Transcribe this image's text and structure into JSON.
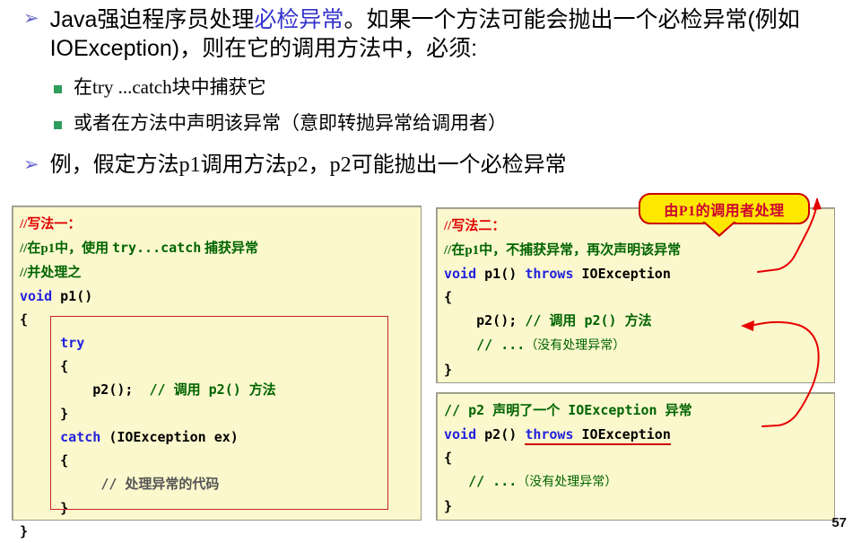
{
  "slide": {
    "page_number": "57",
    "bullets": [
      {
        "marker": "➢",
        "segments": [
          {
            "text": "Java强迫程序员处理",
            "style": "normal"
          },
          {
            "text": "必检异常",
            "style": "blue"
          },
          {
            "text": "。如果一个方法可能会抛出一个必检异常(例如IOException)，则在它的调用方法中，必须:",
            "style": "normal"
          }
        ]
      }
    ],
    "sub_bullets": [
      {
        "text": "在try ...catch块中捕获它"
      },
      {
        "text": "或者在方法中声明该异常（意即转抛异常给调用者）"
      }
    ],
    "bullet_example": {
      "marker": "➢",
      "text": "例，假定方法p1调用方法p2，p2可能抛出一个必检异常"
    },
    "callout": {
      "text": "由P1的调用者处理",
      "fill": "#ffe800",
      "border": "#cc0000",
      "text_color": "#cc0033"
    },
    "code_left": {
      "title_comment": "//写法一：",
      "lines": [
        "//写法一：",
        "//在p1中，使用 try...catch 捕获异常",
        "//并处理之",
        "void p1()",
        "{",
        "    try",
        "    {",
        "        p2();  // 调用 p2() 方法",
        "    }",
        "    catch (IOException ex)",
        "    {",
        "        // 处理异常的代码",
        "    }",
        "}"
      ]
    },
    "code_right_top": {
      "lines": [
        "//写法二：",
        "//在p1中，不捕获异常，再次声明该异常",
        "void p1() throws IOException",
        "{",
        "    p2(); // 调用 p2() 方法",
        "    // ...（没有处理异常）",
        "}"
      ]
    },
    "code_right_bottom": {
      "lines": [
        "// p2 声明了一个 IOException 异常",
        "void p2() throws IOException",
        "{",
        "   // ...（没有处理异常）",
        "}"
      ]
    },
    "colors": {
      "code_background": "#fbf8cd",
      "comment_green": "#006400",
      "comment_red": "#e00000",
      "keyword_blue": "#2222dd",
      "annotation_red": "#cc0000",
      "bullet_marker_blue": "#6666cc",
      "sub_bullet_green": "#2e9e5b"
    }
  }
}
